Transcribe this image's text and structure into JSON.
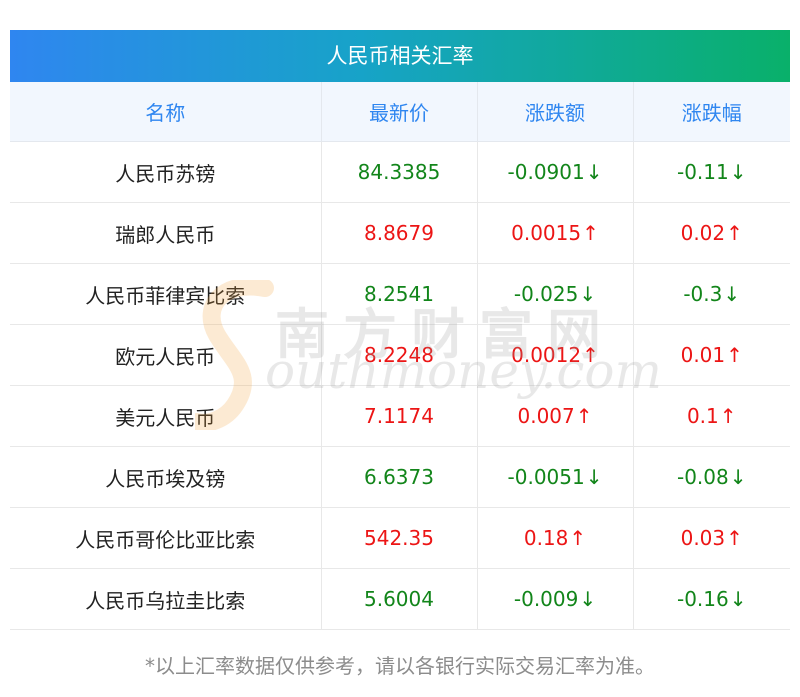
{
  "title": "人民币相关汇率",
  "columns": [
    "名称",
    "最新价",
    "涨跌额",
    "涨跌幅"
  ],
  "rows": [
    {
      "name": "人民币苏镑",
      "price": "84.3385",
      "change": "-0.0901",
      "percent": "-0.11",
      "trend": "down",
      "arrow": "↓"
    },
    {
      "name": "瑞郎人民币",
      "price": "8.8679",
      "change": "0.0015",
      "percent": "0.02",
      "trend": "up",
      "arrow": "↑"
    },
    {
      "name": "人民币菲律宾比索",
      "price": "8.2541",
      "change": "-0.025",
      "percent": "-0.3",
      "trend": "down",
      "arrow": "↓"
    },
    {
      "name": "欧元人民币",
      "price": "8.2248",
      "change": "0.0012",
      "percent": "0.01",
      "trend": "up",
      "arrow": "↑"
    },
    {
      "name": "美元人民币",
      "price": "7.1174",
      "change": "0.007",
      "percent": "0.1",
      "trend": "up",
      "arrow": "↑"
    },
    {
      "name": "人民币埃及镑",
      "price": "6.6373",
      "change": "-0.0051",
      "percent": "-0.08",
      "trend": "down",
      "arrow": "↓"
    },
    {
      "name": "人民币哥伦比亚比索",
      "price": "542.35",
      "change": "0.18",
      "percent": "0.03",
      "trend": "up",
      "arrow": "↑"
    },
    {
      "name": "人民币乌拉圭比索",
      "price": "5.6004",
      "change": "-0.009",
      "percent": "-0.16",
      "trend": "down",
      "arrow": "↓"
    }
  ],
  "footnote": "*以上汇率数据仅供参考，请以各银行实际交易汇率为准。",
  "watermark": {
    "cn": "南方财富网",
    "en": "outhmoney.com"
  },
  "colors": {
    "up": "#ec1515",
    "down": "#12851a",
    "header_text": "#2f86f0",
    "title_gradient_start": "#2f86f0",
    "title_gradient_end": "#09b06a"
  }
}
